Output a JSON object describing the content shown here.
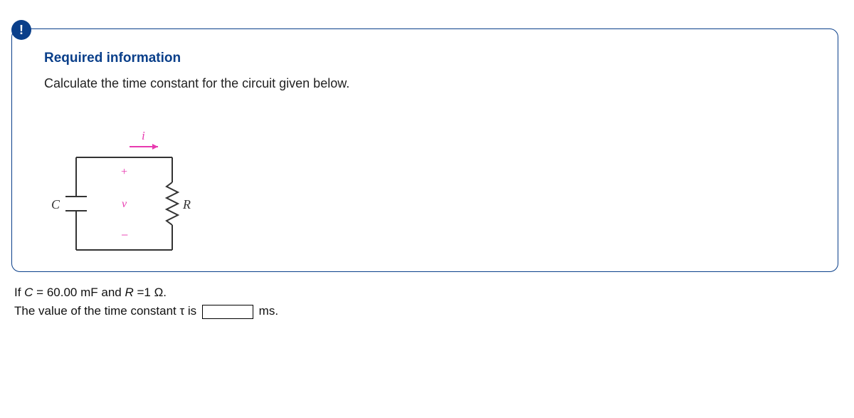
{
  "badge": "!",
  "box": {
    "title": "Required information",
    "body": "Calculate the time constant for the circuit given below."
  },
  "circuit": {
    "cap_label": "C",
    "res_label": "R",
    "cur_label": "i",
    "v_label": "v",
    "plus": "+",
    "minus": "−"
  },
  "question": {
    "given_prefix": "If ",
    "given_C_sym": "C",
    "given_C_eq": " = 60.00 mF and ",
    "given_R_sym": "R",
    "given_R_eq": " =1 Ω.",
    "line2_pre": "The value of the time constant τ is",
    "unit": "ms.",
    "input_value": ""
  }
}
